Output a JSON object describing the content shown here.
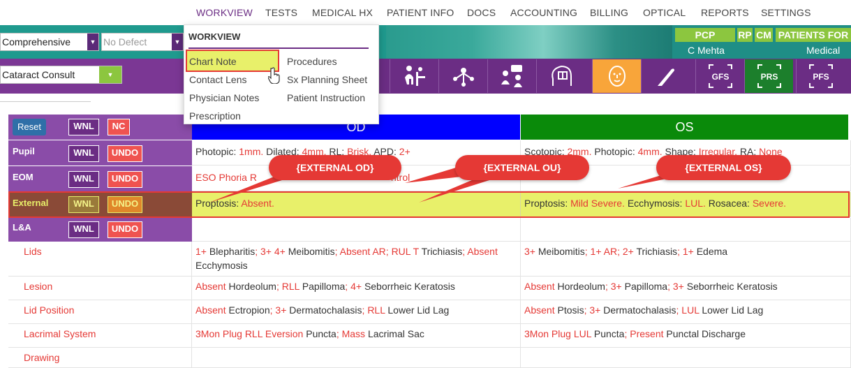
{
  "nav": {
    "items": [
      "WORKVIEW",
      "TESTS",
      "MEDICAL HX",
      "PATIENT INFO",
      "DOCS",
      "ACCOUNTING",
      "BILLING",
      "OPTICAL",
      "REPORTS",
      "SETTINGS"
    ]
  },
  "filters": {
    "exam_type": "Comprehensive",
    "defect": "No Defect",
    "visit_type": "Cataract Consult"
  },
  "header": {
    "pcp_label": "PCP",
    "rp_label": "RP",
    "cm_label": "CM",
    "patients_label": "PATIENTS FOR",
    "pcp_name": "C Mehta",
    "medical_label": "Medical"
  },
  "toolbar": {
    "icons": [
      "exam-icon",
      "network-icon",
      "consult-icon",
      "head-book-icon",
      "face-icon",
      "scalpel-icon",
      "GFS",
      "PRS",
      "PFS"
    ]
  },
  "menu": {
    "title": "WORKVIEW",
    "col1": [
      "Chart Note",
      "Contact Lens",
      "Physician Notes",
      "Prescription"
    ],
    "col2": [
      "Procedures",
      "Sx Planning Sheet",
      "Patient Instruction"
    ]
  },
  "table": {
    "reset_label": "Reset",
    "wnl_label": "WNL",
    "nc_label": "NC",
    "undo_label": "UNDO",
    "od_header": "OD",
    "os_header": "OS",
    "rows": {
      "pupil": {
        "label": "Pupil",
        "od": [
          [
            "Photopic: ",
            ""
          ],
          [
            "1mm.",
            "r"
          ],
          [
            " Dilated: ",
            ""
          ],
          [
            "4mm.",
            "r"
          ],
          [
            " RL: ",
            ""
          ],
          [
            "Brisk.",
            "r"
          ],
          [
            " APD: ",
            ""
          ],
          [
            "2+",
            "r"
          ]
        ],
        "os": [
          [
            "Scotopic: ",
            ""
          ],
          [
            "2mm.",
            "r"
          ],
          [
            " Photopic: ",
            ""
          ],
          [
            "4mm.",
            "r"
          ],
          [
            " Shape: ",
            ""
          ],
          [
            "Irregular.",
            "r"
          ],
          [
            " RA: ",
            ""
          ],
          [
            "None",
            "r"
          ]
        ]
      },
      "eom": {
        "label": "EOM",
        "od": [
          [
            "ESO Phoria R",
            "r"
          ]
        ],
        "od_tail": "ntrol"
      },
      "external": {
        "label": "External",
        "od": [
          [
            "Proptosis: ",
            ""
          ],
          [
            "Absent.",
            "r"
          ]
        ],
        "os": [
          [
            "Proptosis: ",
            ""
          ],
          [
            "Mild Severe.",
            "r"
          ],
          [
            " Ecchymosis: ",
            ""
          ],
          [
            "LUL.",
            "r"
          ],
          [
            " Rosacea: ",
            ""
          ],
          [
            "Severe.",
            "r"
          ]
        ]
      },
      "la": {
        "label": "L&A"
      },
      "lids": {
        "label": "Lids",
        "od": [
          [
            "1+ ",
            "r"
          ],
          [
            "Blepharitis",
            ""
          ],
          [
            "; 3+ 4+ ",
            "r"
          ],
          [
            "Meibomitis",
            ""
          ],
          [
            "; Absent AR; RUL T ",
            "r"
          ],
          [
            "Trichiasis",
            ""
          ],
          [
            "; Absent",
            "r"
          ]
        ],
        "od2": "Ecchymosis",
        "os": [
          [
            "3+ ",
            "r"
          ],
          [
            "Meibomitis",
            ""
          ],
          [
            "; 1+ AR; 2+ ",
            "r"
          ],
          [
            "Trichiasis",
            ""
          ],
          [
            "; 1+ ",
            "r"
          ],
          [
            "Edema",
            ""
          ]
        ]
      },
      "lesion": {
        "label": "Lesion",
        "od": [
          [
            "Absent ",
            "r"
          ],
          [
            "Hordeolum",
            ""
          ],
          [
            "; RLL ",
            "r"
          ],
          [
            "Papilloma",
            ""
          ],
          [
            "; 4+ ",
            "r"
          ],
          [
            "Seborrheic Keratosis",
            ""
          ]
        ],
        "os": [
          [
            "Absent ",
            "r"
          ],
          [
            "Hordeolum",
            ""
          ],
          [
            "; 3+ ",
            "r"
          ],
          [
            "Papilloma",
            ""
          ],
          [
            "; 3+ ",
            "r"
          ],
          [
            "Seborrheic Keratosis",
            ""
          ]
        ]
      },
      "lid_position": {
        "label": "Lid Position",
        "od": [
          [
            "Absent ",
            "r"
          ],
          [
            "Ectropion",
            ""
          ],
          [
            "; 3+ ",
            "r"
          ],
          [
            "Dermatochalasis",
            ""
          ],
          [
            "; RLL ",
            "r"
          ],
          [
            "Lower Lid Lag",
            ""
          ]
        ],
        "os": [
          [
            "Absent ",
            "r"
          ],
          [
            "Ptosis",
            ""
          ],
          [
            "; 3+ ",
            "r"
          ],
          [
            "Dermatochalasis",
            ""
          ],
          [
            "; LUL ",
            "r"
          ],
          [
            "Lower Lid Lag",
            ""
          ]
        ]
      },
      "lacrimal": {
        "label": "Lacrimal System",
        "od": [
          [
            "3Mon Plug RLL Eversion ",
            "r"
          ],
          [
            "Puncta",
            ""
          ],
          [
            "; Mass ",
            "r"
          ],
          [
            "Lacrimal Sac",
            ""
          ]
        ],
        "os": [
          [
            "3Mon Plug LUL ",
            "r"
          ],
          [
            "Puncta",
            ""
          ],
          [
            "; Present ",
            "r"
          ],
          [
            "Punctal Discharge",
            ""
          ]
        ]
      },
      "drawing": {
        "label": "Drawing"
      }
    }
  },
  "callouts": {
    "od": "{EXTERNAL OD}",
    "ou": "{EXTERNAL OU}",
    "os": "{EXTERNAL OS}"
  },
  "colors": {
    "purple": "#6b2d84",
    "od_blue": "#0000ff",
    "os_green": "#0a8a0a",
    "highlight": "#e8f06a",
    "alert_red": "#e53935"
  }
}
